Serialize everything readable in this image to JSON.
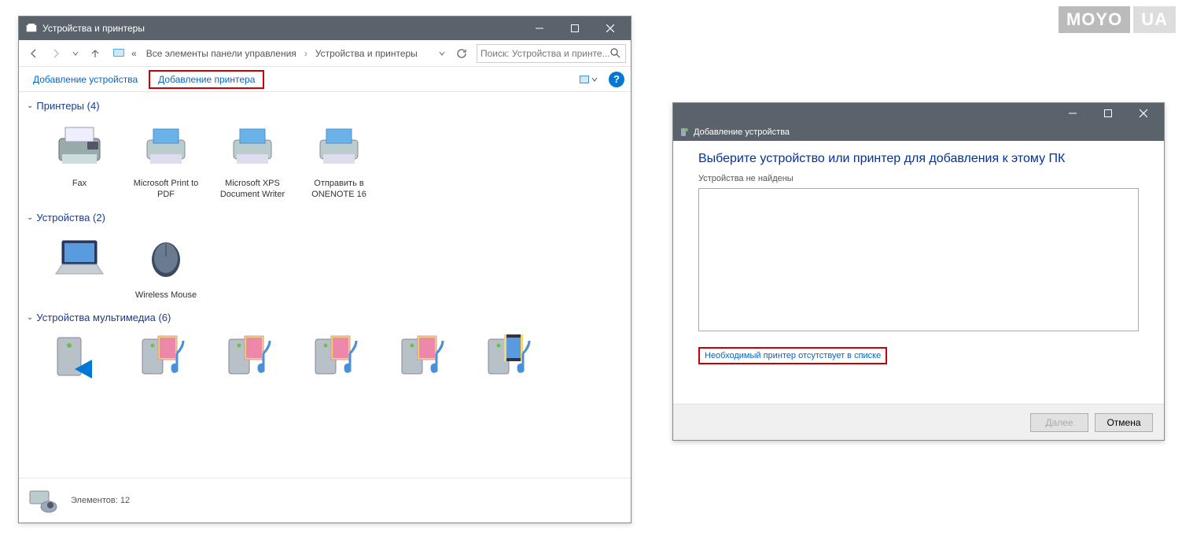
{
  "watermark": {
    "part1": "MOYO",
    "part2": "UA"
  },
  "window1": {
    "title": "Устройства и принтеры",
    "breadcrumb": {
      "prefix": "«",
      "part1": "Все элементы панели управления",
      "part2": "Устройства и принтеры"
    },
    "search_placeholder": "Поиск: Устройства и принте...",
    "toolbar": {
      "add_device": "Добавление устройства",
      "add_printer": "Добавление принтера"
    },
    "groups": {
      "printers": {
        "label": "Принтеры (4)",
        "items": [
          {
            "label": "Fax"
          },
          {
            "label": "Microsoft Print to PDF"
          },
          {
            "label": "Microsoft XPS Document Writer"
          },
          {
            "label": "Отправить в ONENOTE 16"
          }
        ]
      },
      "devices": {
        "label": "Устройства (2)",
        "items": [
          {
            "label": ""
          },
          {
            "label": "Wireless Mouse"
          }
        ]
      },
      "multimedia": {
        "label": "Устройства мультимедиа (6)",
        "items": [
          {
            "label": ""
          },
          {
            "label": ""
          },
          {
            "label": ""
          },
          {
            "label": ""
          },
          {
            "label": ""
          },
          {
            "label": ""
          }
        ]
      }
    },
    "status": {
      "count_label": "Элементов: 12"
    }
  },
  "window2": {
    "title": "Добавление устройства",
    "heading": "Выберите устройство или принтер для добавления к этому ПК",
    "subtext": "Устройства не найдены",
    "missing_link": "Необходимый принтер отсутствует в списке",
    "next_btn": "Далее",
    "cancel_btn": "Отмена"
  }
}
